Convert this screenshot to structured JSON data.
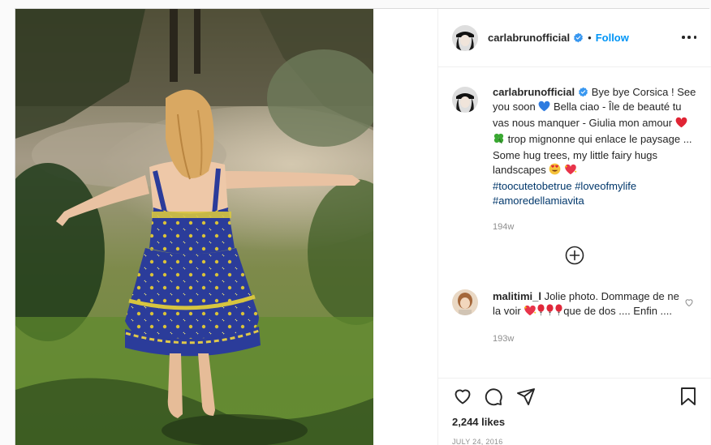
{
  "post": {
    "author": "carlabrunofficial",
    "follow_separator": "•",
    "follow_label": "Follow",
    "caption": {
      "username": "carlabrunofficial",
      "segments": [
        {
          "t": " Bye bye Corsica ! See you soon "
        },
        {
          "emoji": "blue-heart"
        },
        {
          "t": " Bella ciao - Île de beauté tu vas nous manquer - Giulia mon amour "
        },
        {
          "emoji": "red-heart"
        },
        {
          "t": " "
        },
        {
          "emoji": "four-leaf-clover"
        },
        {
          "t": " trop mignonne qui enlace le paysage ... Some hug trees, my little fairy hugs landscapes "
        },
        {
          "emoji": "heart-eyes-face"
        },
        {
          "t": " "
        },
        {
          "emoji": "sparkling-heart"
        },
        {
          "br": true
        },
        {
          "tag": "#toocutetobetrue"
        },
        {
          "t": " "
        },
        {
          "tag": "#loveofmylife"
        },
        {
          "br": true
        },
        {
          "tag": "#amoredellamiavita"
        }
      ],
      "time": "194w"
    },
    "comment": {
      "username": "malitimi_l",
      "segments": [
        {
          "t": " Jolie photo. Dommage de ne la voir "
        },
        {
          "emoji": "sparkling-heart"
        },
        {
          "emoji": "balloon"
        },
        {
          "emoji": "balloon"
        },
        {
          "emoji": "balloon"
        },
        {
          "t": "que de dos .... Enfin ...."
        }
      ],
      "time": "193w"
    },
    "likes": "2,244 likes",
    "date": "JULY 24, 2016",
    "icons": [
      "verified-badge-icon",
      "more-options-icon",
      "load-more-comments-icon",
      "comment-like-heart-icon",
      "like-icon",
      "comment-icon",
      "share-icon",
      "save-bookmark-icon"
    ],
    "colors": {
      "accent": "#0095f6",
      "hashtag": "#00376b",
      "muted": "#8e8e8e",
      "text": "#262626"
    }
  }
}
